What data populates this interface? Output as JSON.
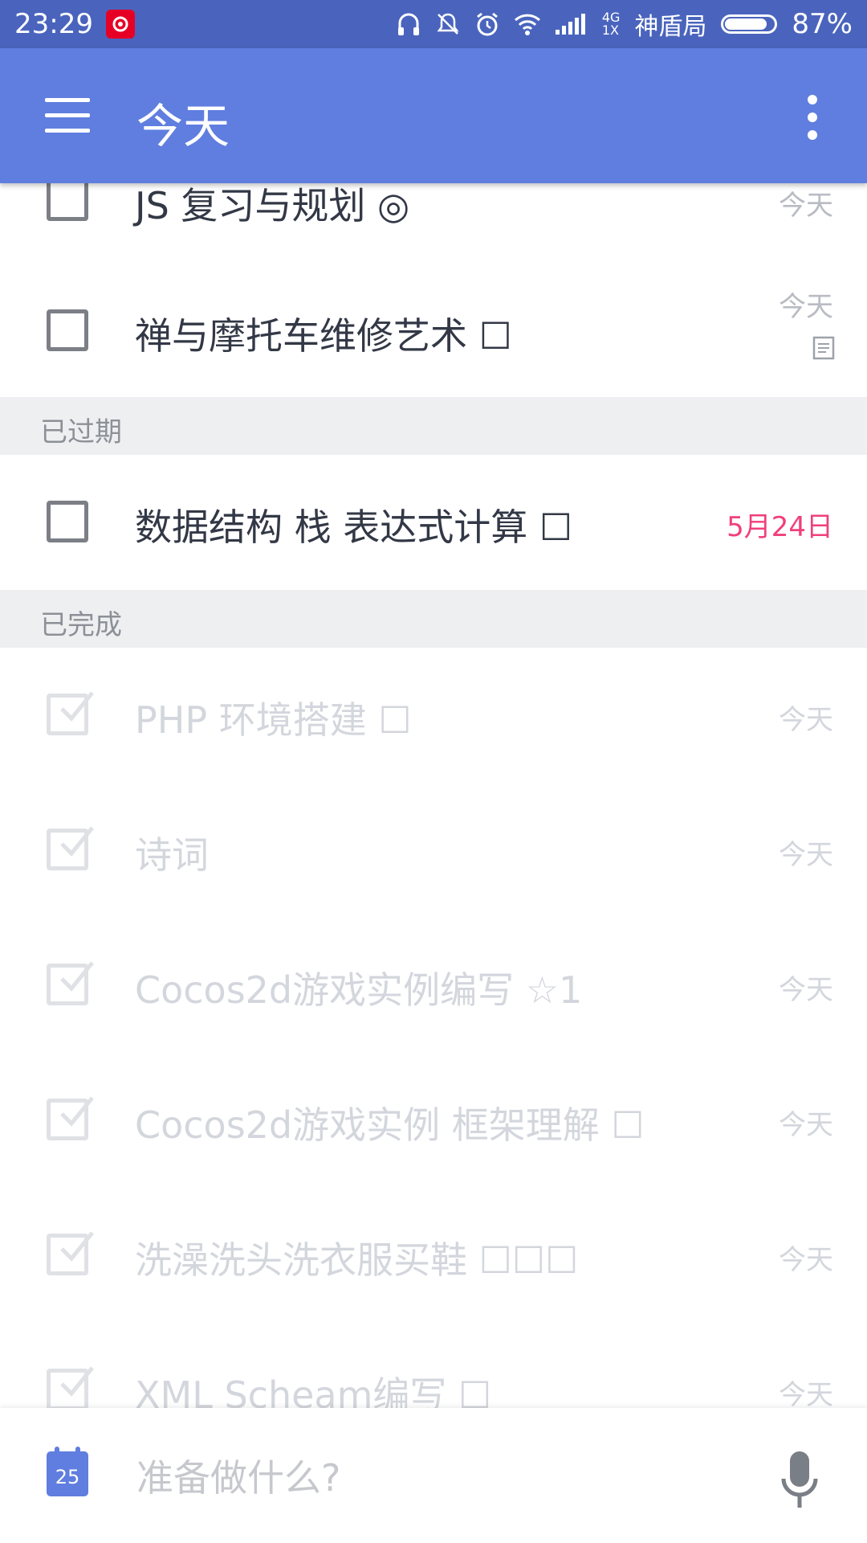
{
  "status_bar": {
    "time": "23:29",
    "network": "4G",
    "network_sub": "1X",
    "carrier": "神盾局",
    "battery": "87%",
    "battery_level": 0.87
  },
  "toolbar": {
    "title": "今天",
    "menu_icon": "menu-icon",
    "more_icon": "more-vert-icon"
  },
  "tasks_today": [
    {
      "title": "JS 复习与规划 ◎",
      "due": "今天"
    },
    {
      "title": "禅与摩托车维修艺术 ☐",
      "due": "今天",
      "has_note": true
    }
  ],
  "sections": {
    "overdue": "已过期",
    "completed": "已完成"
  },
  "tasks_overdue": [
    {
      "title": "数据结构 栈 表达式计算 ☐",
      "due": "5月24日"
    }
  ],
  "tasks_completed": [
    {
      "title": "PHP 环境搭建 ☐",
      "due": "今天"
    },
    {
      "title": "诗词",
      "due": "今天"
    },
    {
      "title": "Cocos2d游戏实例编写 ☆1",
      "due": "今天"
    },
    {
      "title": "Cocos2d游戏实例 框架理解 ☐",
      "due": "今天"
    },
    {
      "title": "洗澡洗头洗衣服买鞋 ☐☐☐",
      "due": "今天"
    },
    {
      "title": "XML Scheam编写 ☐",
      "due": "今天"
    }
  ],
  "bottom": {
    "calendar_day": "25",
    "placeholder": "准备做什么?"
  },
  "colors": {
    "toolbar": "#5f7edf",
    "status_bar": "#4a64bd",
    "overdue": "#f0407b"
  }
}
